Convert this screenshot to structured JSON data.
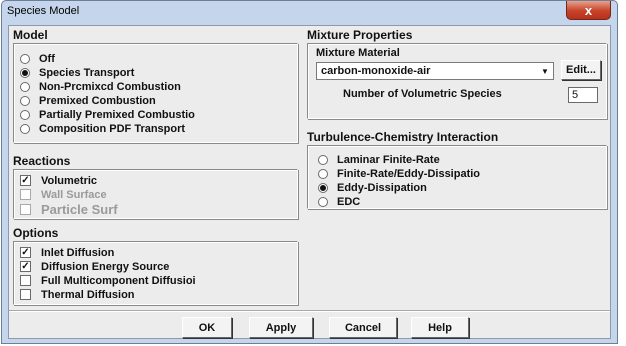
{
  "window": {
    "title": "Species Model",
    "close_glyph": "x"
  },
  "model": {
    "heading": "Model",
    "options": [
      {
        "label": "Off",
        "selected": false
      },
      {
        "label": "Species Transport",
        "selected": true
      },
      {
        "label": "Non-Prcmixcd Combustion",
        "selected": false
      },
      {
        "label": "Premixed Combustion",
        "selected": false
      },
      {
        "label": "Partially Premixed Combustio",
        "selected": false
      },
      {
        "label": "Composition PDF Transport",
        "selected": false
      }
    ]
  },
  "reactions": {
    "heading": "Reactions",
    "items": [
      {
        "label": "Volumetric",
        "checked": true,
        "enabled": true
      },
      {
        "label": "Wall Surface",
        "checked": false,
        "enabled": false
      },
      {
        "label": "Particle Surf",
        "checked": false,
        "enabled": false
      }
    ]
  },
  "options": {
    "heading": "Options",
    "items": [
      {
        "label": "Inlet Diffusion",
        "checked": true
      },
      {
        "label": "Diffusion Energy Source",
        "checked": true
      },
      {
        "label": "Full Multicomponent Diffusioi",
        "checked": false
      },
      {
        "label": "Thermal Diffusion",
        "checked": false
      }
    ]
  },
  "mixture": {
    "heading": "Mixture Properties",
    "material_label": "Mixture Material",
    "material_value": "carbon-monoxide-air",
    "edit_label": "Edit...",
    "species_label": "Number of Volumetric Species",
    "species_value": "5"
  },
  "turbulence": {
    "heading": "Turbulence-Chemistry Interaction",
    "options": [
      {
        "label": "Laminar Finite-Rate",
        "selected": false
      },
      {
        "label": "Finite-Rate/Eddy-Dissipatio",
        "selected": false
      },
      {
        "label": "Eddy-Dissipation",
        "selected": true
      },
      {
        "label": "EDC",
        "selected": false
      }
    ]
  },
  "buttons": {
    "ok": "OK",
    "apply": "Apply",
    "cancel": "Cancel",
    "help": "Help"
  },
  "colors": {
    "title_bg": "#c4d5ec",
    "close_red": "#c7432a",
    "panel_bg": "#ececec"
  }
}
